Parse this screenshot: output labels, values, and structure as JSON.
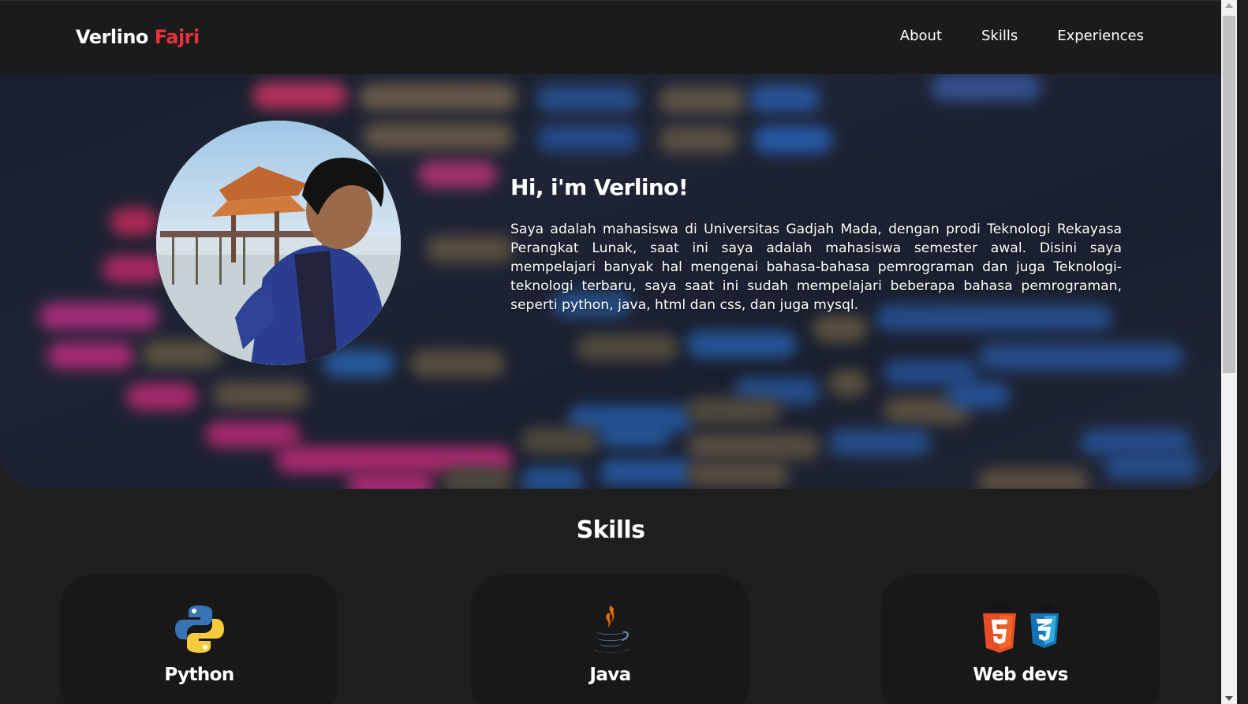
{
  "brand": {
    "first": "Verlino",
    "last": "Fajri"
  },
  "nav": {
    "items": [
      {
        "label": "About"
      },
      {
        "label": "Skills"
      },
      {
        "label": "Experiences"
      }
    ]
  },
  "hero": {
    "title": "Hi, i'm Verlino!",
    "description": "Saya adalah mahasiswa di Universitas Gadjah Mada, dengan prodi Teknologi Rekayasa Perangkat Lunak, saat ini saya adalah mahasiswa semester awal. Disini saya mempelajari banyak hal mengenai bahasa-bahasa pemrograman dan juga Teknologi-teknologi terbaru, saya saat ini sudah mempelajari beberapa bahasa pemrograman, seperti python, java, html dan css, dan juga mysql."
  },
  "skills": {
    "title": "Skills",
    "cards": [
      {
        "label": "Python",
        "icon": "python-logo-icon"
      },
      {
        "label": "Java",
        "icon": "java-logo-icon"
      },
      {
        "label": "Web devs",
        "icon": "html5-css3-logo-icon",
        "icon_texts": [
          "HTML",
          "CSS"
        ]
      }
    ]
  },
  "colors": {
    "accent": "#e8313b",
    "background": "#1e1e1e",
    "navbar": "#1b1b1b",
    "card": "#181818"
  }
}
